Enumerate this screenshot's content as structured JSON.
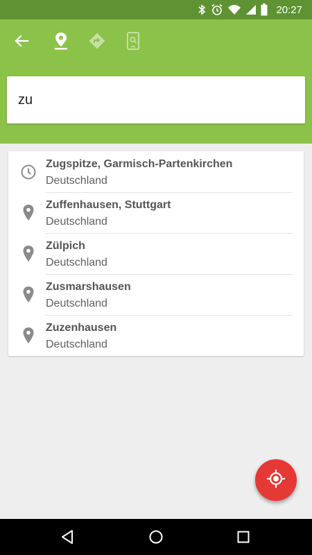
{
  "status_bar": {
    "time": "20:27",
    "icons": [
      "bluetooth-icon",
      "alarm-icon",
      "wifi-icon",
      "signal-icon",
      "battery-icon"
    ]
  },
  "toolbar": {
    "icons": [
      "back-arrow-icon",
      "location-pin-icon",
      "directions-icon",
      "phone-search-icon"
    ]
  },
  "search": {
    "value": "zu"
  },
  "results": [
    {
      "icon": "history-clock-icon",
      "title": "Zugspitze, Garmisch-Partenkirchen",
      "subtitle": "Deutschland"
    },
    {
      "icon": "location-pin-icon",
      "title": "Zuffenhausen, Stuttgart",
      "subtitle": "Deutschland"
    },
    {
      "icon": "location-pin-icon",
      "title": "Zülpich",
      "subtitle": "Deutschland"
    },
    {
      "icon": "location-pin-icon",
      "title": "Zusmarshausen",
      "subtitle": "Deutschland"
    },
    {
      "icon": "location-pin-icon",
      "title": "Zuzenhausen",
      "subtitle": "Deutschland"
    }
  ],
  "fab": {
    "icon": "my-location-icon"
  },
  "nav_bar": {
    "icons": [
      "nav-back-icon",
      "nav-home-icon",
      "nav-recents-icon"
    ]
  },
  "colors": {
    "status_bar": "#5e9233",
    "header": "#8bc34a",
    "fab": "#e53935",
    "background": "#eeeeee"
  }
}
